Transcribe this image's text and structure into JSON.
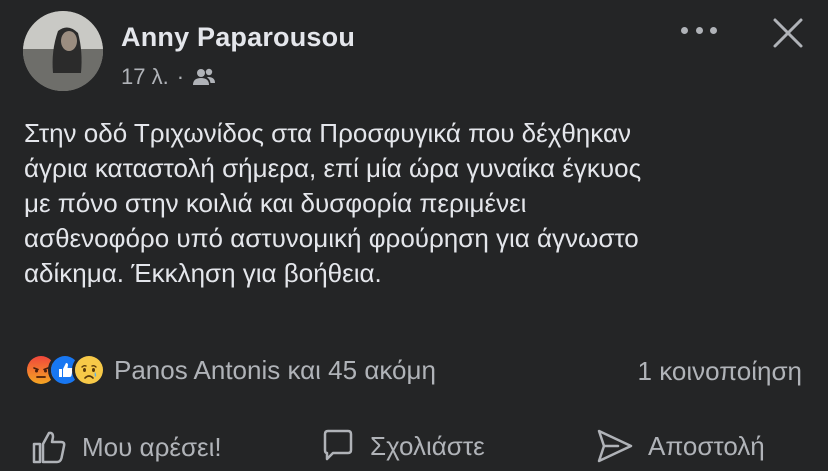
{
  "post": {
    "author": "Anny Paparousou",
    "time": "17 λ.",
    "separator": "·",
    "audience_icon": "friends-icon",
    "text": "Στην οδό Τριχωνίδος στα Προσφυγικά που δέχθηκαν\nάγρια καταστολή σήμερα, επί μία ώρα γυναίκα έγκυος\nμε πόνο στην κοιλιά και δυσφορία περιμένει\nασθενοφόρο υπό αστυνομική φρούρηση για άγνωστο\nαδίκημα. Έκκληση για βοήθεια."
  },
  "reactions": {
    "icons": [
      "angry-reaction-icon",
      "like-reaction-icon",
      "sad-reaction-icon"
    ],
    "summary": "Panos Antonis και 45 ακόμη",
    "shares": "1 κοινοποίηση"
  },
  "actions": {
    "like": "Μου αρέσει!",
    "comment": "Σχολιάστε",
    "send": "Αποστολή"
  },
  "colors": {
    "background": "#242526",
    "text": "#e4e6eb",
    "secondary": "#b0b3b8",
    "like_blue": "#1877f2"
  }
}
